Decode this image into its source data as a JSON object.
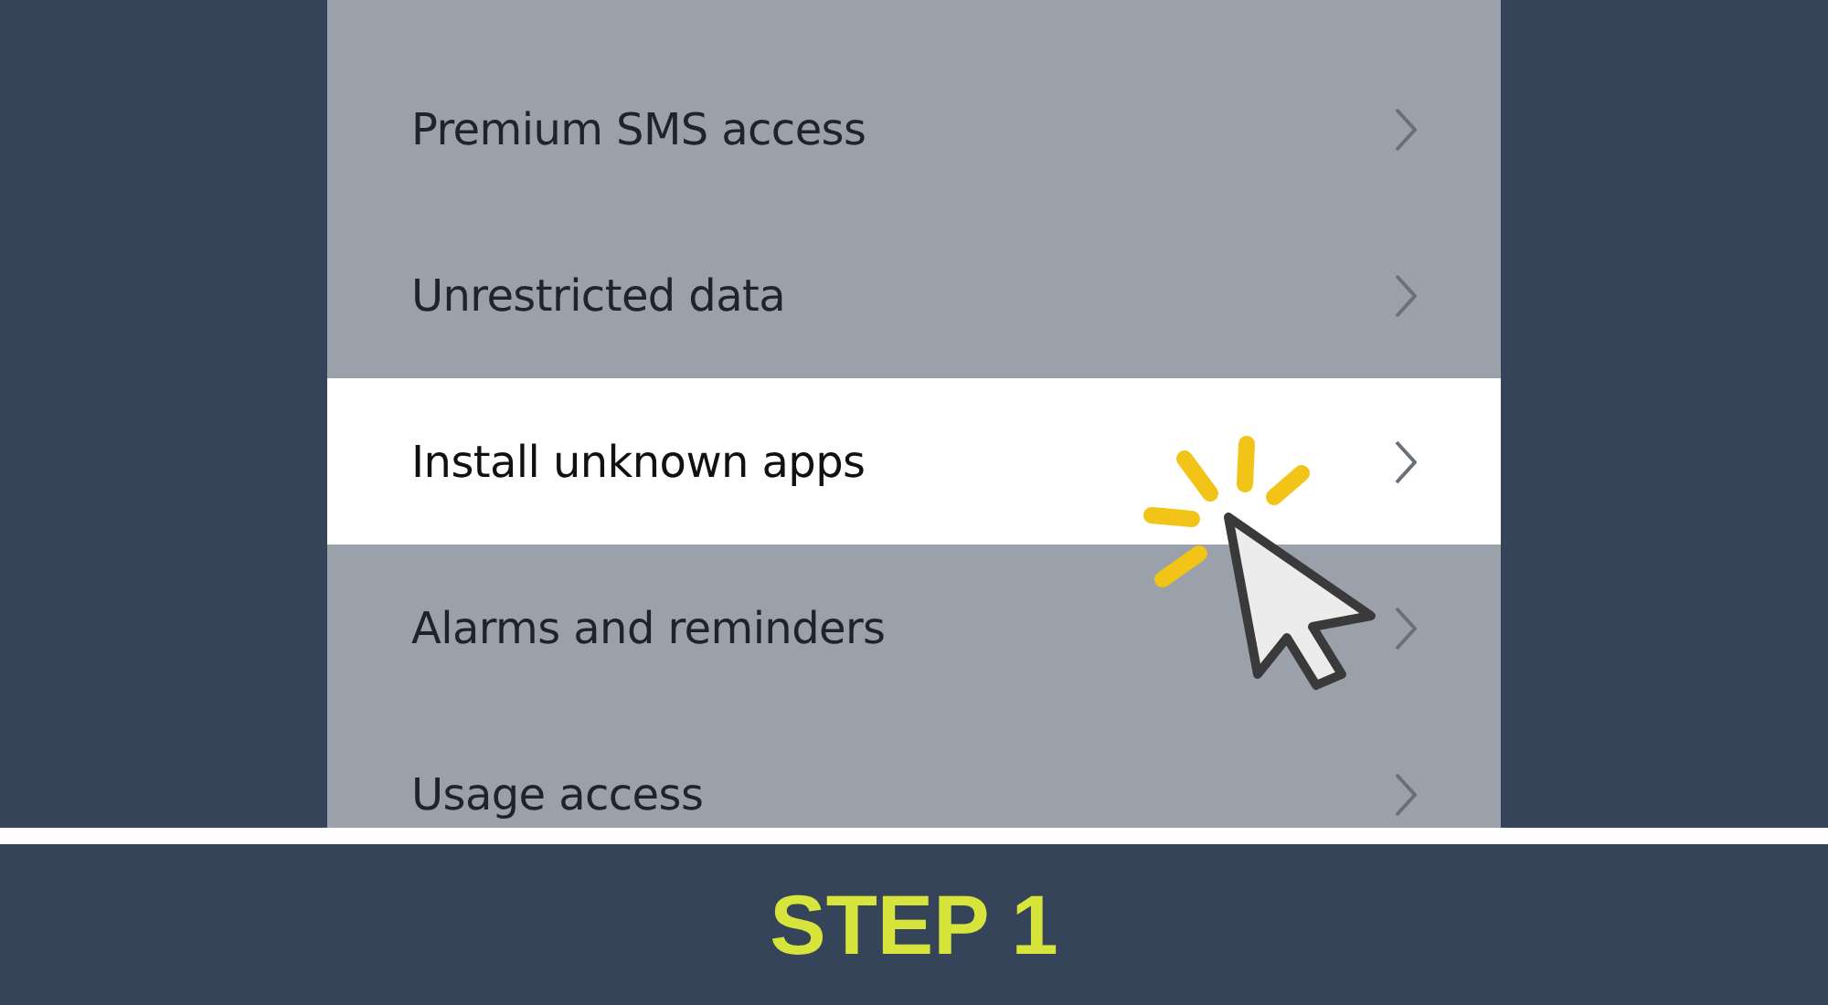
{
  "settings_list": [
    {
      "label": "Premium SMS access",
      "selected": false
    },
    {
      "label": "Unrestricted data",
      "selected": false
    },
    {
      "label": "Install unknown apps",
      "selected": true
    },
    {
      "label": "Alarms and reminders",
      "selected": false
    },
    {
      "label": "Usage access",
      "selected": false
    }
  ],
  "caption": "STEP 1"
}
